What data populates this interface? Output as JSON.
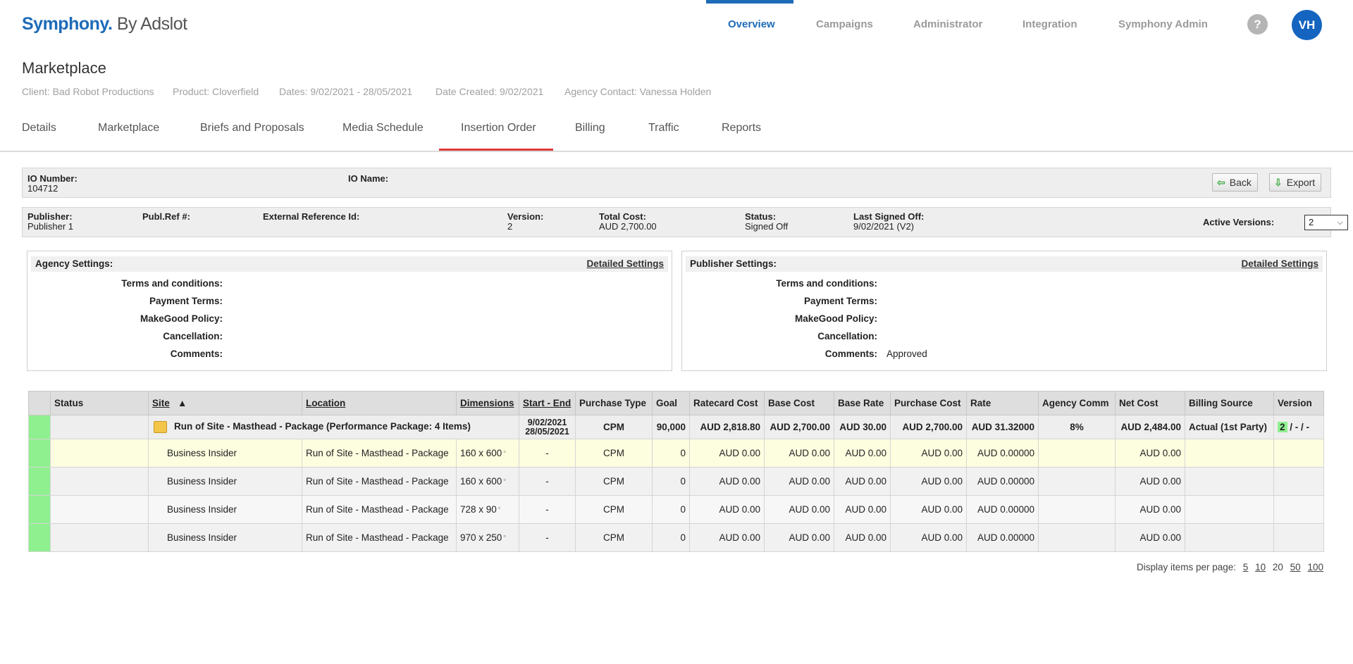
{
  "brand": {
    "name": "Symphony.",
    "by": "By Adslot"
  },
  "nav": [
    {
      "label": "Overview"
    },
    {
      "label": "Campaigns"
    },
    {
      "label": "Administrator"
    },
    {
      "label": "Integration"
    },
    {
      "label": "Symphony Admin"
    }
  ],
  "help_label": "?",
  "user_initials": "VH",
  "page_title": "Marketplace",
  "meta": {
    "client": "Client: Bad Robot Productions",
    "product": "Product: Cloverfield",
    "dates": "Dates: 9/02/2021 - 28/05/2021",
    "created": "Date Created: 9/02/2021",
    "contact": "Agency Contact: Vanessa Holden"
  },
  "tabs": [
    {
      "label": "Details"
    },
    {
      "label": "Marketplace"
    },
    {
      "label": "Briefs and Proposals"
    },
    {
      "label": "Media Schedule"
    },
    {
      "label": "Insertion Order"
    },
    {
      "label": "Billing"
    },
    {
      "label": "Traffic"
    },
    {
      "label": "Reports"
    }
  ],
  "io": {
    "number_label": "IO Number:",
    "number": "104712",
    "name_label": "IO Name:",
    "name": "",
    "back_label": "Back",
    "export_label": "Export"
  },
  "io_info": {
    "publisher_label": "Publisher:",
    "publisher": "Publisher 1",
    "pubref_label": "Publ.Ref #:",
    "pubref": "",
    "extref_label": "External Reference Id:",
    "extref": "",
    "version_label": "Version:",
    "version": "2",
    "total_label": "Total Cost:",
    "total": "AUD 2,700.00",
    "status_label": "Status:",
    "status": "Signed Off",
    "signed_label": "Last Signed Off:",
    "signed": "9/02/2021 (V2)",
    "active_label": "Active Versions:",
    "active_value": "2"
  },
  "agency_settings": {
    "title": "Agency Settings:",
    "link": "Detailed Settings",
    "terms_label": "Terms and conditions:",
    "terms": "",
    "payment_label": "Payment Terms:",
    "payment": "",
    "makegood_label": "MakeGood Policy:",
    "makegood": "",
    "cancel_label": "Cancellation:",
    "cancel": "",
    "comments_label": "Comments:",
    "comments": ""
  },
  "publisher_settings": {
    "title": "Publisher Settings:",
    "link": "Detailed Settings",
    "terms_label": "Terms and conditions:",
    "terms": "",
    "payment_label": "Payment Terms:",
    "payment": "",
    "makegood_label": "MakeGood Policy:",
    "makegood": "",
    "cancel_label": "Cancellation:",
    "cancel": "",
    "comments_label": "Comments:",
    "comments": "Approved"
  },
  "grid": {
    "headers": {
      "status": "Status",
      "site": "Site",
      "sort": "▲",
      "location": "Location",
      "dimensions": "Dimensions",
      "start_end": "Start - End",
      "purchase_type": "Purchase Type",
      "goal": "Goal",
      "ratecard": "Ratecard Cost",
      "base_cost": "Base Cost",
      "base_rate": "Base Rate",
      "purchase_cost": "Purchase Cost",
      "rate": "Rate",
      "agency_comm": "Agency Comm",
      "net_cost": "Net Cost",
      "billing_source": "Billing Source",
      "version": "Version"
    },
    "package": {
      "name": "Run of Site - Masthead - Package (Performance Package: 4 Items)",
      "start": "9/02/2021",
      "end": "28/05/2021",
      "purchase_type": "CPM",
      "goal": "90,000",
      "ratecard": "AUD 2,818.80",
      "base_cost": "AUD 2,700.00",
      "base_rate": "AUD 30.00",
      "purchase_cost": "AUD 2,700.00",
      "rate": "AUD 31.32000",
      "agency_comm": "8%",
      "net_cost": "AUD 2,484.00",
      "billing_source": "Actual (1st Party)",
      "version_num": "2",
      "version_rest": "/ - / -"
    },
    "rows": [
      {
        "site": "Business Insider",
        "location": "Run of Site - Masthead - Package",
        "dimensions": "160 x 600",
        "start_end": "-",
        "purchase_type": "CPM",
        "goal": "0",
        "ratecard": "AUD 0.00",
        "base_cost": "AUD 0.00",
        "base_rate": "AUD 0.00",
        "purchase_cost": "AUD 0.00",
        "rate": "AUD 0.00000",
        "net_cost": "AUD 0.00"
      },
      {
        "site": "Business Insider",
        "location": "Run of Site - Masthead - Package",
        "dimensions": "160 x 600",
        "start_end": "-",
        "purchase_type": "CPM",
        "goal": "0",
        "ratecard": "AUD 0.00",
        "base_cost": "AUD 0.00",
        "base_rate": "AUD 0.00",
        "purchase_cost": "AUD 0.00",
        "rate": "AUD 0.00000",
        "net_cost": "AUD 0.00"
      },
      {
        "site": "Business Insider",
        "location": "Run of Site - Masthead - Package",
        "dimensions": "728 x 90",
        "start_end": "-",
        "purchase_type": "CPM",
        "goal": "0",
        "ratecard": "AUD 0.00",
        "base_cost": "AUD 0.00",
        "base_rate": "AUD 0.00",
        "purchase_cost": "AUD 0.00",
        "rate": "AUD 0.00000",
        "net_cost": "AUD 0.00"
      },
      {
        "site": "Business Insider",
        "location": "Run of Site - Masthead - Package",
        "dimensions": "970 x 250",
        "start_end": "-",
        "purchase_type": "CPM",
        "goal": "0",
        "ratecard": "AUD 0.00",
        "base_cost": "AUD 0.00",
        "base_rate": "AUD 0.00",
        "purchase_cost": "AUD 0.00",
        "rate": "AUD 0.00000",
        "net_cost": "AUD 0.00"
      }
    ],
    "dim_icon": "▫"
  },
  "pager": {
    "label": "Display items per page:",
    "options": [
      "5",
      "10",
      "20",
      "50",
      "100"
    ]
  },
  "colors": {
    "brand": "#1e6bb8",
    "active_tab": "#e03a3a",
    "status_swatch": "#8ff08f",
    "highlight_row": "#fdfde0"
  }
}
